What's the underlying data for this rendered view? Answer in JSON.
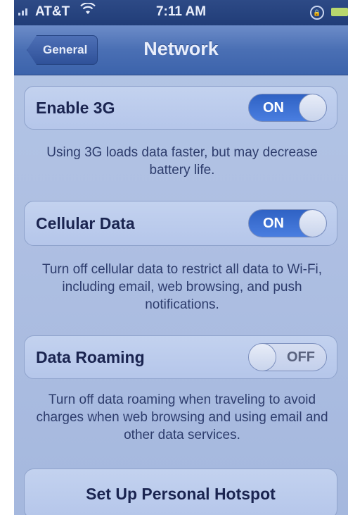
{
  "status_bar": {
    "carrier": "AT&T",
    "time": "7:11 AM"
  },
  "nav": {
    "back_label": "General",
    "title": "Network"
  },
  "settings": [
    {
      "label": "Enable 3G",
      "toggle": "ON",
      "footnote": "Using 3G loads data faster, but may decrease battery life."
    },
    {
      "label": "Cellular Data",
      "toggle": "ON",
      "footnote": "Turn off cellular data to restrict all data to Wi-Fi, including email, web browsing, and push notifications."
    },
    {
      "label": "Data Roaming",
      "toggle": "OFF",
      "footnote": "Turn off data roaming when traveling to avoid charges when web browsing and using email and other data services."
    }
  ],
  "hotspot": {
    "label": "Set Up Personal Hotspot"
  },
  "colors": {
    "nav_bar": "#4a6fb4",
    "toggle_on": "#2f62c4",
    "background": "#aebfe2"
  },
  "icons": {
    "signal": "signal-bars-icon",
    "wifi": "wifi-icon",
    "rotation_lock": "rotation-lock-icon",
    "battery": "battery-icon"
  }
}
